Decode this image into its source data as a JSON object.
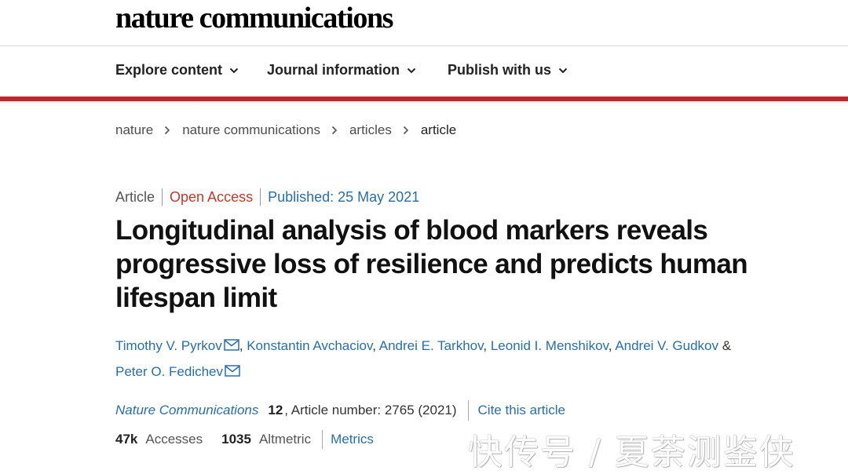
{
  "masthead": {
    "brand": "nature communications"
  },
  "nav": {
    "items": [
      {
        "label": "Explore content"
      },
      {
        "label": "Journal information"
      },
      {
        "label": "Publish with us"
      }
    ]
  },
  "breadcrumb": {
    "items": [
      "nature",
      "nature communications",
      "articles"
    ],
    "current": "article"
  },
  "article": {
    "type": "Article",
    "access": "Open Access",
    "published": "Published: 25 May 2021",
    "title": "Longitudinal analysis of blood markers reveals progressive loss of resilience and predicts human lifespan limit",
    "authors": [
      {
        "name": "Timothy V. Pyrkov",
        "corresponding": true
      },
      {
        "name": "Konstantin Avchaciov",
        "corresponding": false
      },
      {
        "name": "Andrei E. Tarkhov",
        "corresponding": false
      },
      {
        "name": "Leonid I. Menshikov",
        "corresponding": false
      },
      {
        "name": "Andrei V. Gudkov",
        "corresponding": false
      },
      {
        "name": "Peter O. Fedichev",
        "corresponding": true
      }
    ],
    "author_separator": ",",
    "author_final_separator": "&",
    "citation": {
      "journal": "Nature Communications",
      "volume": "12",
      "article_number": ", Article number: 2765 (2021)",
      "cite_label": "Cite this article"
    },
    "metrics": {
      "accesses_value": "47k",
      "accesses_label": "Accesses",
      "altmetric_value": "1035",
      "altmetric_label": "Altmetric",
      "metrics_label": "Metrics"
    }
  },
  "watermark": "快传号 / 夏荼测鉴侠",
  "colors": {
    "accent_red": "#c0262d",
    "link_blue": "#2a6ea6",
    "open_access_red": "#c0392b"
  }
}
